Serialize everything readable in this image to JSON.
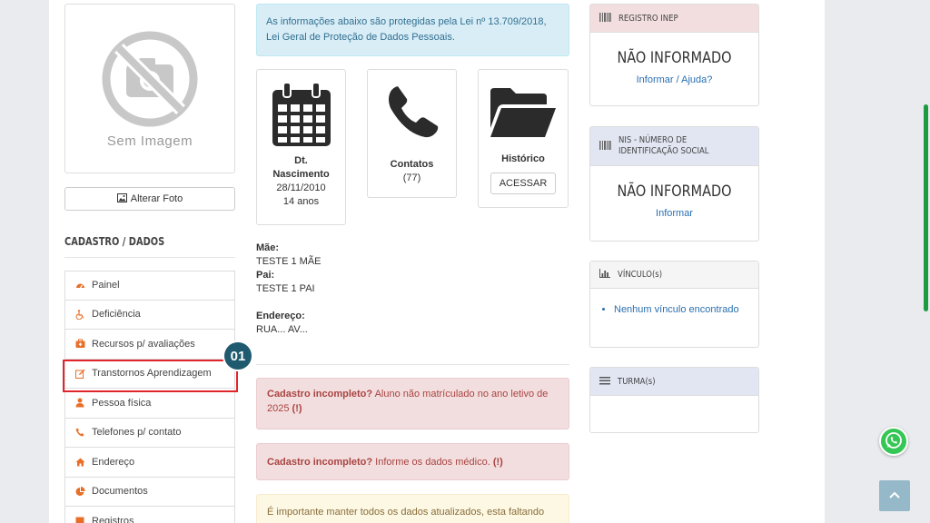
{
  "photo": {
    "placeholder": "Sem Imagem",
    "change_button": "Alterar Foto"
  },
  "sidebar": {
    "title": "CADASTRO / DADOS",
    "items": [
      {
        "label": "Painel",
        "icon": "dashboard-icon"
      },
      {
        "label": "Deficiência",
        "icon": "wheelchair-icon"
      },
      {
        "label": "Recursos p/ avaliações",
        "icon": "medkit-icon"
      },
      {
        "label": "Transtornos Aprendizagem",
        "icon": "edit-icon"
      },
      {
        "label": "Pessoa física",
        "icon": "user-icon"
      },
      {
        "label": "Telefones p/ contato",
        "icon": "phone-icon"
      },
      {
        "label": "Endereço",
        "icon": "home-icon"
      },
      {
        "label": "Documentos",
        "icon": "pie-chart-icon"
      },
      {
        "label": "Registros",
        "icon": "registry-icon"
      }
    ]
  },
  "step_badge": "01",
  "lgpd": {
    "line1": "As informações abaixo são protegidas pela Lei nº 13.709/2018,",
    "line2": "Lei Geral de Proteção de Dados Pessoais."
  },
  "cards": {
    "birth": {
      "label_line1": "Dt.",
      "label_line2": "Nascimento",
      "date": "28/11/2010",
      "age": "14 anos"
    },
    "contacts": {
      "label": "Contatos",
      "count": "(77)"
    },
    "history": {
      "label": "Histórico",
      "button": "ACESSAR"
    }
  },
  "person": {
    "mother_label": "Mãe:",
    "mother": "TESTE 1 MÃE",
    "father_label": "Pai:",
    "father": "TESTE 1 PAI",
    "address_label": "Endereço:",
    "address": "RUA... AV..."
  },
  "alerts": {
    "a1_bold": "Cadastro incompleto?",
    "a1_text": " Aluno não matrículado no ano letivo de",
    "a1_line2": "2025 ",
    "a1_mark": "(!)",
    "a2_bold": "Cadastro incompleto?",
    "a2_text": " Informe os dados médico. ",
    "a2_mark": "(!)",
    "warning": "É importante manter todos os dados atualizados, esta faltando"
  },
  "panels": {
    "inep": {
      "title": "REGISTRO INEP",
      "value": "NÃO INFORMADO",
      "link": "Informar / Ajuda?"
    },
    "nis": {
      "title_line1": "NIS - NÚMERO DE",
      "title_line2": "IDENTIFICAÇÃO SOCIAL",
      "value": "NÃO INFORMADO",
      "link": "Informar"
    },
    "vinculo": {
      "title": "VÍNCULO(s)",
      "item": "Nenhum vínculo encontrado"
    },
    "turma": {
      "title": "TURMA(s)"
    }
  },
  "colors": {
    "accent_orange": "#e86f28",
    "highlight_red": "#e0262a",
    "badge": "#1f5a6e",
    "link": "#2a6fb0",
    "whatsapp": "#35c755"
  }
}
